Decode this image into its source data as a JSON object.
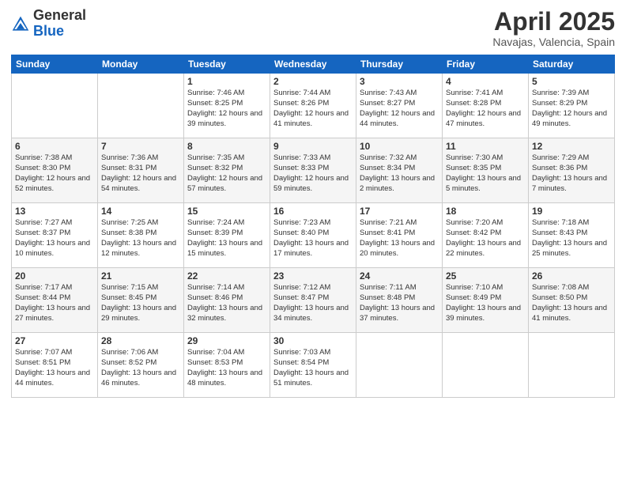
{
  "header": {
    "logo_general": "General",
    "logo_blue": "Blue",
    "month_title": "April 2025",
    "location": "Navajas, Valencia, Spain"
  },
  "weekdays": [
    "Sunday",
    "Monday",
    "Tuesday",
    "Wednesday",
    "Thursday",
    "Friday",
    "Saturday"
  ],
  "weeks": [
    [
      {
        "day": "",
        "empty": true
      },
      {
        "day": "",
        "empty": true
      },
      {
        "day": "1",
        "sunrise": "Sunrise: 7:46 AM",
        "sunset": "Sunset: 8:25 PM",
        "daylight": "Daylight: 12 hours and 39 minutes."
      },
      {
        "day": "2",
        "sunrise": "Sunrise: 7:44 AM",
        "sunset": "Sunset: 8:26 PM",
        "daylight": "Daylight: 12 hours and 41 minutes."
      },
      {
        "day": "3",
        "sunrise": "Sunrise: 7:43 AM",
        "sunset": "Sunset: 8:27 PM",
        "daylight": "Daylight: 12 hours and 44 minutes."
      },
      {
        "day": "4",
        "sunrise": "Sunrise: 7:41 AM",
        "sunset": "Sunset: 8:28 PM",
        "daylight": "Daylight: 12 hours and 47 minutes."
      },
      {
        "day": "5",
        "sunrise": "Sunrise: 7:39 AM",
        "sunset": "Sunset: 8:29 PM",
        "daylight": "Daylight: 12 hours and 49 minutes."
      }
    ],
    [
      {
        "day": "6",
        "sunrise": "Sunrise: 7:38 AM",
        "sunset": "Sunset: 8:30 PM",
        "daylight": "Daylight: 12 hours and 52 minutes."
      },
      {
        "day": "7",
        "sunrise": "Sunrise: 7:36 AM",
        "sunset": "Sunset: 8:31 PM",
        "daylight": "Daylight: 12 hours and 54 minutes."
      },
      {
        "day": "8",
        "sunrise": "Sunrise: 7:35 AM",
        "sunset": "Sunset: 8:32 PM",
        "daylight": "Daylight: 12 hours and 57 minutes."
      },
      {
        "day": "9",
        "sunrise": "Sunrise: 7:33 AM",
        "sunset": "Sunset: 8:33 PM",
        "daylight": "Daylight: 12 hours and 59 minutes."
      },
      {
        "day": "10",
        "sunrise": "Sunrise: 7:32 AM",
        "sunset": "Sunset: 8:34 PM",
        "daylight": "Daylight: 13 hours and 2 minutes."
      },
      {
        "day": "11",
        "sunrise": "Sunrise: 7:30 AM",
        "sunset": "Sunset: 8:35 PM",
        "daylight": "Daylight: 13 hours and 5 minutes."
      },
      {
        "day": "12",
        "sunrise": "Sunrise: 7:29 AM",
        "sunset": "Sunset: 8:36 PM",
        "daylight": "Daylight: 13 hours and 7 minutes."
      }
    ],
    [
      {
        "day": "13",
        "sunrise": "Sunrise: 7:27 AM",
        "sunset": "Sunset: 8:37 PM",
        "daylight": "Daylight: 13 hours and 10 minutes."
      },
      {
        "day": "14",
        "sunrise": "Sunrise: 7:25 AM",
        "sunset": "Sunset: 8:38 PM",
        "daylight": "Daylight: 13 hours and 12 minutes."
      },
      {
        "day": "15",
        "sunrise": "Sunrise: 7:24 AM",
        "sunset": "Sunset: 8:39 PM",
        "daylight": "Daylight: 13 hours and 15 minutes."
      },
      {
        "day": "16",
        "sunrise": "Sunrise: 7:23 AM",
        "sunset": "Sunset: 8:40 PM",
        "daylight": "Daylight: 13 hours and 17 minutes."
      },
      {
        "day": "17",
        "sunrise": "Sunrise: 7:21 AM",
        "sunset": "Sunset: 8:41 PM",
        "daylight": "Daylight: 13 hours and 20 minutes."
      },
      {
        "day": "18",
        "sunrise": "Sunrise: 7:20 AM",
        "sunset": "Sunset: 8:42 PM",
        "daylight": "Daylight: 13 hours and 22 minutes."
      },
      {
        "day": "19",
        "sunrise": "Sunrise: 7:18 AM",
        "sunset": "Sunset: 8:43 PM",
        "daylight": "Daylight: 13 hours and 25 minutes."
      }
    ],
    [
      {
        "day": "20",
        "sunrise": "Sunrise: 7:17 AM",
        "sunset": "Sunset: 8:44 PM",
        "daylight": "Daylight: 13 hours and 27 minutes."
      },
      {
        "day": "21",
        "sunrise": "Sunrise: 7:15 AM",
        "sunset": "Sunset: 8:45 PM",
        "daylight": "Daylight: 13 hours and 29 minutes."
      },
      {
        "day": "22",
        "sunrise": "Sunrise: 7:14 AM",
        "sunset": "Sunset: 8:46 PM",
        "daylight": "Daylight: 13 hours and 32 minutes."
      },
      {
        "day": "23",
        "sunrise": "Sunrise: 7:12 AM",
        "sunset": "Sunset: 8:47 PM",
        "daylight": "Daylight: 13 hours and 34 minutes."
      },
      {
        "day": "24",
        "sunrise": "Sunrise: 7:11 AM",
        "sunset": "Sunset: 8:48 PM",
        "daylight": "Daylight: 13 hours and 37 minutes."
      },
      {
        "day": "25",
        "sunrise": "Sunrise: 7:10 AM",
        "sunset": "Sunset: 8:49 PM",
        "daylight": "Daylight: 13 hours and 39 minutes."
      },
      {
        "day": "26",
        "sunrise": "Sunrise: 7:08 AM",
        "sunset": "Sunset: 8:50 PM",
        "daylight": "Daylight: 13 hours and 41 minutes."
      }
    ],
    [
      {
        "day": "27",
        "sunrise": "Sunrise: 7:07 AM",
        "sunset": "Sunset: 8:51 PM",
        "daylight": "Daylight: 13 hours and 44 minutes."
      },
      {
        "day": "28",
        "sunrise": "Sunrise: 7:06 AM",
        "sunset": "Sunset: 8:52 PM",
        "daylight": "Daylight: 13 hours and 46 minutes."
      },
      {
        "day": "29",
        "sunrise": "Sunrise: 7:04 AM",
        "sunset": "Sunset: 8:53 PM",
        "daylight": "Daylight: 13 hours and 48 minutes."
      },
      {
        "day": "30",
        "sunrise": "Sunrise: 7:03 AM",
        "sunset": "Sunset: 8:54 PM",
        "daylight": "Daylight: 13 hours and 51 minutes."
      },
      {
        "day": "",
        "empty": true
      },
      {
        "day": "",
        "empty": true
      },
      {
        "day": "",
        "empty": true
      }
    ]
  ]
}
